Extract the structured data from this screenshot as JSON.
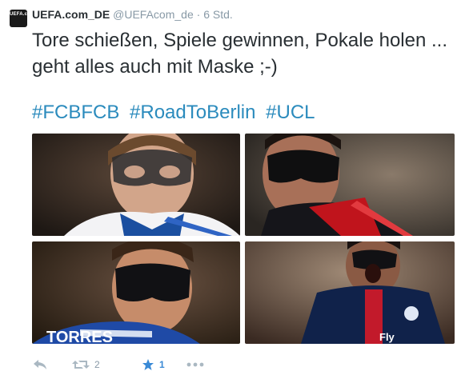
{
  "tweet": {
    "avatar_text": "UEFA.com",
    "display_name": "UEFA.com_DE",
    "handle": "@UEFAcom_de",
    "separator": "·",
    "time": "6 Std.",
    "text": "Tore schießen, Spiele gewinnen, Pokale holen ... geht alles auch mit Maske ;-)",
    "hashtags": [
      "#FCBFCB",
      "#RoadToBerlin",
      "#UCL"
    ]
  },
  "photos": [
    {
      "description_icon": "photo"
    },
    {
      "description_icon": "photo"
    },
    {
      "description_icon": "photo",
      "jersey_text": "TORRES"
    },
    {
      "description_icon": "photo",
      "jersey_text": "Fly"
    }
  ],
  "actions": {
    "retweet_count": "2",
    "favorite_count": "1"
  },
  "colors": {
    "hashtag": "#2b8bbd",
    "muted": "#8899a6",
    "favorite": "#3a8ad6"
  }
}
